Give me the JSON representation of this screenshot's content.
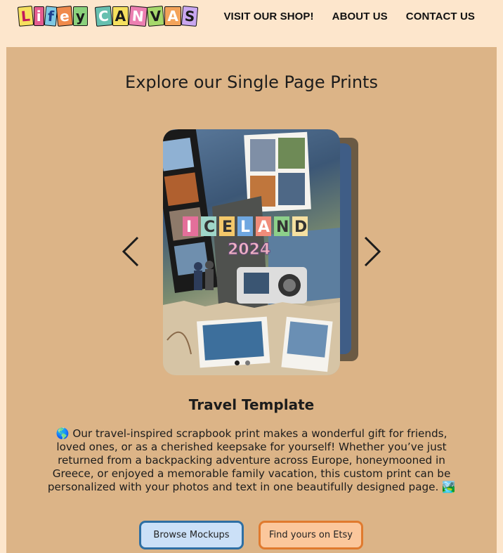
{
  "header": {
    "logo_text": "LIFEY CANVAS",
    "logo_letters": [
      "L",
      "i",
      "f",
      "e",
      "y",
      " ",
      "C",
      "A",
      "N",
      "V",
      "A",
      "S"
    ],
    "nav": [
      {
        "label": "VISIT OUR SHOP!"
      },
      {
        "label": "ABOUT US"
      },
      {
        "label": "CONTACT US"
      }
    ]
  },
  "main": {
    "heading": "Explore our Single Page Prints",
    "carousel": {
      "slide_title": "ICELAND",
      "slide_year": "2024",
      "active_index": 0,
      "slide_count": 2
    },
    "template_title": "Travel Template",
    "description": "🌎 Our travel-inspired scrapbook print makes a wonderful gift for friends, loved ones, or as a cherished keepsake for yourself! Whether you’ve just returned from a backpacking adventure across Europe, honeymooned in Greece, or enjoyed a memorable family vacation, this custom print can be personalized with your photos and text in one beautifully designed page. 🏞️",
    "buttons": {
      "browse": "Browse Mockups",
      "etsy": "Find yours on Etsy"
    }
  },
  "colors": {
    "page_bg": "#fde6cc",
    "panel_bg": "#dcb487",
    "browse_bg": "#cbe0f7",
    "browse_border": "#2e6fa3",
    "etsy_bg": "#fbc79c",
    "etsy_border": "#e07a2e"
  }
}
